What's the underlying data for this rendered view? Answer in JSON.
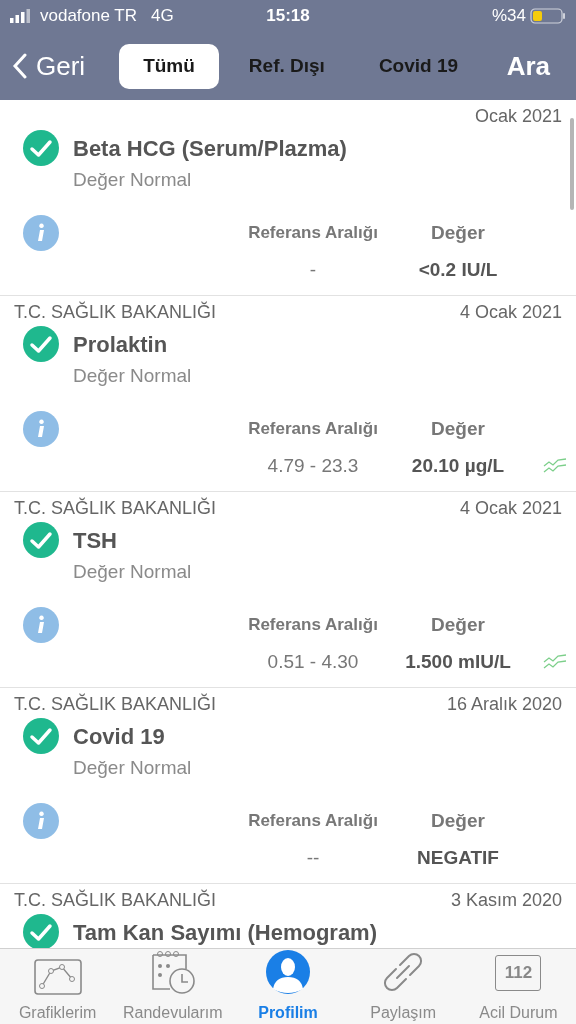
{
  "status_bar": {
    "carrier": "vodafone TR",
    "network": "4G",
    "time": "15:18",
    "battery": "%34"
  },
  "nav": {
    "back": "Geri",
    "tabs": [
      {
        "label": "Tümü",
        "selected": true
      },
      {
        "label": "Ref. Dışı",
        "selected": false
      },
      {
        "label": "Covid 19",
        "selected": false
      }
    ],
    "action": "Ara"
  },
  "results": [
    {
      "date": "Ocak 2021",
      "name": "Beta HCG (Serum/Plazma)",
      "status": "Değer Normal",
      "normal": true,
      "range_label": "Referans Aralığı",
      "value_label": "Değer",
      "range": "-",
      "value": "<0.2 IU/L",
      "trend": false
    },
    {
      "source": "T.C. SAĞLIK BAKANLIĞI",
      "date": "4 Ocak 2021",
      "name": "Prolaktin",
      "status": "Değer Normal",
      "normal": true,
      "range_label": "Referans Aralığı",
      "value_label": "Değer",
      "range": "4.79 - 23.3",
      "value": "20.10 µg/L",
      "trend": true
    },
    {
      "source": "T.C. SAĞLIK BAKANLIĞI",
      "date": "4 Ocak 2021",
      "name": "TSH",
      "status": "Değer Normal",
      "normal": true,
      "range_label": "Referans Aralığı",
      "value_label": "Değer",
      "range": "0.51 - 4.30",
      "value": "1.500 mIU/L",
      "trend": true
    },
    {
      "source": "T.C. SAĞLIK BAKANLIĞI",
      "date": "16 Aralık 2020",
      "name": "Covid 19",
      "status": "Değer Normal",
      "normal": true,
      "range_label": "Referans Aralığı",
      "value_label": "Değer",
      "range": "--",
      "value": "NEGATIF",
      "trend": false
    },
    {
      "source": "T.C. SAĞLIK BAKANLIĞI",
      "date": "3 Kasım 2020",
      "name": "Tam Kan Sayımı (Hemogram)",
      "normal": true
    }
  ],
  "tab_bar": [
    {
      "kind": "chart",
      "label": "Grafiklerim",
      "selected": false
    },
    {
      "kind": "calendar",
      "label": "Randevularım",
      "selected": false
    },
    {
      "kind": "profile",
      "label": "Profilim",
      "selected": true
    },
    {
      "kind": "link",
      "label": "Paylaşım",
      "selected": false
    },
    {
      "kind": "emergency",
      "label": "Acil Durum",
      "selected": false,
      "badge": "112"
    }
  ]
}
